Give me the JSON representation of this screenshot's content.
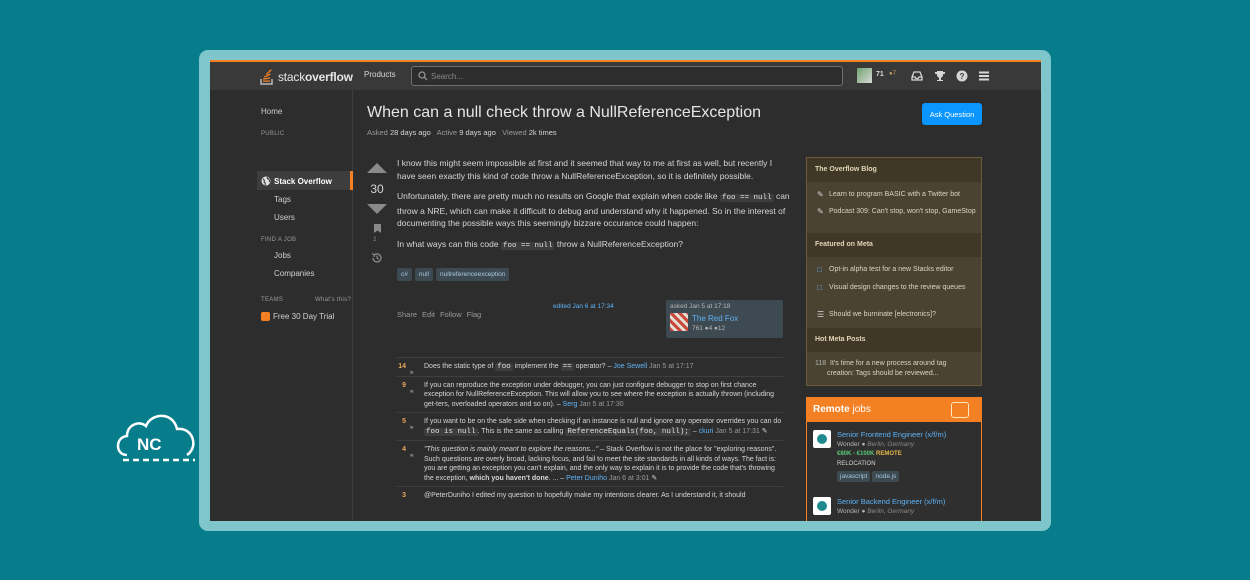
{
  "brand": {
    "logo_left": "NC"
  },
  "topbar": {
    "logo_plain": "stack",
    "logo_bold": "overflow",
    "products": "Products",
    "search_placeholder": "Search...",
    "reputation": "71",
    "bronze": "●7"
  },
  "leftnav": {
    "home": "Home",
    "public": "PUBLIC",
    "stack_overflow": "Stack Overflow",
    "tags": "Tags",
    "users": "Users",
    "find_job": "FIND A JOB",
    "jobs": "Jobs",
    "companies": "Companies",
    "teams": "TEAMS",
    "whats_this": "What's this?",
    "trial": "Free 30 Day Trial"
  },
  "question": {
    "title": "When can a null check throw a NullReferenceException",
    "asked_label": "Asked",
    "asked_value": "28 days ago",
    "active_label": "Active",
    "active_value": "9 days ago",
    "viewed_label": "Viewed",
    "viewed_value": "2k times",
    "ask_button": "Ask Question",
    "score": "30",
    "bookmarks": "2",
    "p1": "I know this might seem impossible at first and it seemed that way to me at first as well, but recently I have seen exactly this kind of code throw a NullReferenceException, so it is definitely possible.",
    "p2a": "Unfortunately, there are pretty much no results on Google that explain when code like",
    "p2_code": "foo == null",
    "p2b": "can throw a NRE, which can make it difficult to debug and understand why it happened. So in the interest of documenting the possible ways this seemingly bizzare occurance could happen:",
    "p3a": "In what ways can this code",
    "p3_code": "foo == null",
    "p3b": "throw a NullReferenceException?",
    "tags": [
      "c#",
      "null",
      "nullreferenceexception"
    ],
    "menu": {
      "share": "Share",
      "edit": "Edit",
      "follow": "Follow",
      "flag": "Flag"
    },
    "edited": "edited Jan 6 at 17:34",
    "owner": {
      "asked": "asked Jan 5 at 17:18",
      "name": "The Red Fox",
      "stats": "761 ●4 ●12"
    }
  },
  "comments": [
    {
      "score": "14",
      "t1": "Does the static type of",
      "c1": "foo",
      "t2": "implement the",
      "c2": "==",
      "t3": "operator? –",
      "user": "Joe Sewell",
      "date": "Jan 5 at 17:17"
    },
    {
      "score": "9",
      "t1": "If you can reproduce the exception under debugger, you can just configure debugger to stop on first chance exception for NullReferenceException. This will allow you to see where the exception is actually thrown (including get-ters, overloaded operators and so on). –",
      "user": "Serg",
      "date": "Jan 5 at 17:30"
    },
    {
      "score": "5",
      "t1": "If you want to be on the safe side when checking if an instance is null and ignore any operator overrides you can do",
      "c1": "foo is null",
      "t2": ". This is the same as calling",
      "c2": "ReferenceEquals(foo, null);",
      "t3": "–",
      "user": "ckuri",
      "date": "Jan 5 at 17:31"
    },
    {
      "score": "4",
      "q": "\"This question is mainly meant to explore the reasons...\"",
      "t1": "– Stack Overflow is not the place for \"exploring reasons\". Such questions are overly broad, lacking focus, and fail to meet the site standards in all kinds of ways. The fact is: you are getting an exception you can't explain, and the only way to explain it is to provide the code that's throwing the exception,",
      "b": "which you haven't done",
      "t2": ". ... –",
      "user": "Peter Duniho",
      "date": "Jan 6 at 3:01"
    },
    {
      "score": "3",
      "t1": "@PeterDuniho I edited my question to hopefully make my intentions clearer. As I understand it, it should"
    }
  ],
  "sidebar": {
    "blog_title": "The Overflow Blog",
    "blog_items": [
      "Learn to program BASIC with a Twitter bot",
      "Podcast 309: Can't stop, won't stop, GameStop"
    ],
    "meta_title": "Featured on Meta",
    "meta_items": [
      "Opt-in alpha test for a new Stacks editor",
      "Visual design changes to the review queues",
      "Should we burninate [electronics]?"
    ],
    "hot_title": "Hot Meta Posts",
    "hot_count": "118",
    "hot_item": "It's time for a new process around tag creation: Tags should be reviewed..."
  },
  "jobs": {
    "title_bold": "Remote",
    "title_light": "jobs",
    "items": [
      {
        "title": "Senior Frontend Engineer (x/f/m)",
        "company": "Wonder",
        "location": "Berlin, Germany",
        "pay": "€80K - €100K",
        "remote": "REMOTE",
        "relocation": "RELOCATION",
        "tags": [
          "javascript",
          "node.js"
        ]
      },
      {
        "title": "Senior Backend Engineer (x/f/m)",
        "company": "Wonder",
        "location": "Berlin, Germany"
      }
    ]
  },
  "colors": {
    "accent": "#f48024",
    "link": "#5eb2f5",
    "page_bg": "#077d8c",
    "ask_button": "#0a95ff"
  }
}
